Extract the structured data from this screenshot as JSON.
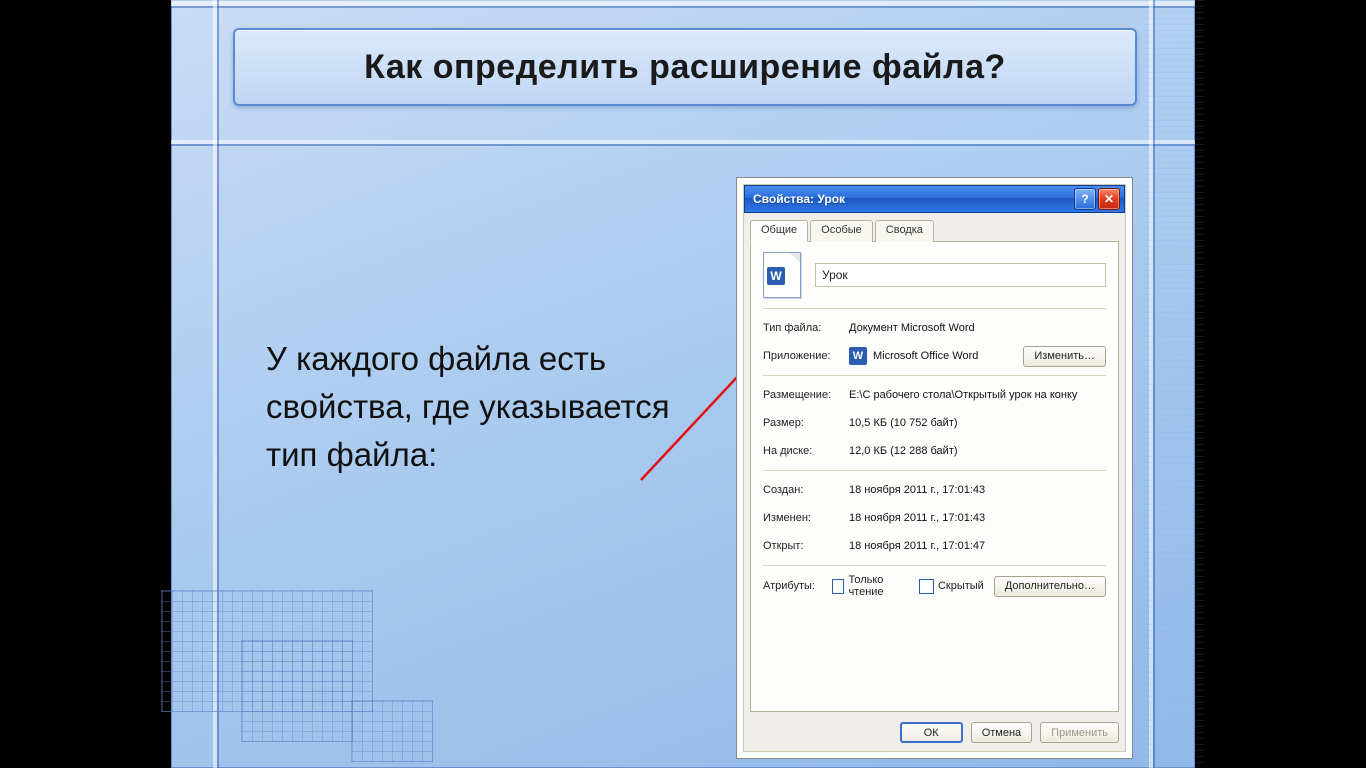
{
  "slide": {
    "title": "Как определить расширение файла?",
    "body": "У каждого файла есть свойства, где указывается тип файла:"
  },
  "dialog": {
    "title": "Свойства: Урок",
    "help_label": "?",
    "close_label": "✕",
    "tabs": {
      "general": "Общие",
      "special": "Особые",
      "summary": "Сводка"
    },
    "filename": "Урок",
    "rows": {
      "file_type_label": "Тип файла:",
      "file_type_value": "Документ Microsoft Word",
      "app_label": "Приложение:",
      "app_value": "Microsoft Office Word",
      "change_btn": "Изменить…",
      "location_label": "Размещение:",
      "location_value": "E:\\С рабочего стола\\Открытый урок на конку",
      "size_label": "Размер:",
      "size_value": "10,5 КБ (10 752 байт)",
      "disk_label": "На диске:",
      "disk_value": "12,0 КБ (12 288 байт)",
      "created_label": "Создан:",
      "created_value": "18 ноября 2011 г., 17:01:43",
      "modified_label": "Изменен:",
      "modified_value": "18 ноября 2011 г., 17:01:43",
      "opened_label": "Открыт:",
      "opened_value": "18 ноября 2011 г., 17:01:47",
      "attr_label": "Атрибуты:",
      "readonly": "Только чтение",
      "hidden": "Скрытый",
      "advanced_btn": "Дополнительно…"
    },
    "footer": {
      "ok": "ОК",
      "cancel": "Отмена",
      "apply": "Применить"
    }
  }
}
